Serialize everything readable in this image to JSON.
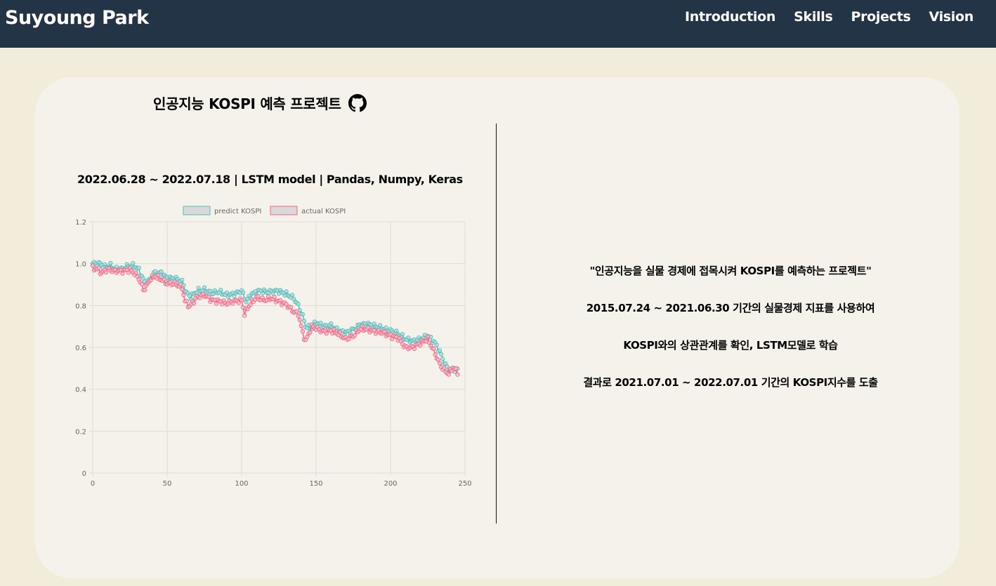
{
  "header": {
    "brand": "Suyoung Park",
    "nav": [
      "Introduction",
      "Skills",
      "Projects",
      "Vision"
    ]
  },
  "project": {
    "title": "인공지능 KOSPI 예측 프로젝트",
    "github_icon": "github-icon",
    "meta": "2022.06.28 ~ 2022.07.18 | LSTM model | Pandas, Numpy, Keras",
    "description": [
      "\"인공지능을 실물 경제에 접목시켜 KOSPI를 예측하는 프로젝트\"",
      "2015.07.24 ~ 2021.06.30 기간의 실물경제 지표를 사용하여",
      "KOSPI와의 상관관계를 확인, LSTM모델로 학습",
      "결과로 2021.07.01 ~ 2022.07.01 기간의 KOSPI지수를 도출"
    ]
  },
  "colors": {
    "navbar": "#243447",
    "background": "#f2ecdb",
    "card": "#f4f2ea",
    "predict": "#4bc0c0",
    "actual": "#ff6384"
  },
  "chart_data": {
    "type": "line",
    "grid": true,
    "legend": "top-center",
    "xlim": [
      0,
      250
    ],
    "ylim": [
      0,
      1.2
    ],
    "xticks": [
      0,
      50,
      100,
      150,
      200,
      250
    ],
    "yticks": [
      0,
      0.2,
      0.4,
      0.6,
      0.8,
      1.0,
      1.2
    ],
    "ytick_labels": [
      "0",
      "0.2",
      "0.4",
      "0.6",
      "0.8",
      "1.0",
      "1.2"
    ],
    "series": [
      {
        "name": "predict KOSPI",
        "color": "#4bc0c0",
        "knots": [
          [
            0,
            1.0
          ],
          [
            5,
            1.0
          ],
          [
            8,
            0.985
          ],
          [
            12,
            0.99
          ],
          [
            15,
            0.975
          ],
          [
            20,
            0.975
          ],
          [
            24,
            0.99
          ],
          [
            28,
            0.99
          ],
          [
            31,
            0.97
          ],
          [
            33,
            0.94
          ],
          [
            35,
            0.91
          ],
          [
            38,
            0.92
          ],
          [
            41,
            0.955
          ],
          [
            46,
            0.955
          ],
          [
            50,
            0.93
          ],
          [
            55,
            0.93
          ],
          [
            60,
            0.915
          ],
          [
            63,
            0.86
          ],
          [
            66,
            0.84
          ],
          [
            70,
            0.87
          ],
          [
            75,
            0.875
          ],
          [
            80,
            0.86
          ],
          [
            85,
            0.865
          ],
          [
            90,
            0.85
          ],
          [
            95,
            0.855
          ],
          [
            100,
            0.87
          ],
          [
            103,
            0.82
          ],
          [
            107,
            0.855
          ],
          [
            112,
            0.87
          ],
          [
            118,
            0.865
          ],
          [
            124,
            0.87
          ],
          [
            130,
            0.855
          ],
          [
            135,
            0.835
          ],
          [
            138,
            0.8
          ],
          [
            141,
            0.75
          ],
          [
            143,
            0.7
          ],
          [
            147,
            0.69
          ],
          [
            150,
            0.72
          ],
          [
            155,
            0.7
          ],
          [
            160,
            0.705
          ],
          [
            165,
            0.68
          ],
          [
            170,
            0.67
          ],
          [
            175,
            0.685
          ],
          [
            180,
            0.71
          ],
          [
            185,
            0.71
          ],
          [
            190,
            0.7
          ],
          [
            195,
            0.69
          ],
          [
            200,
            0.68
          ],
          [
            205,
            0.665
          ],
          [
            210,
            0.64
          ],
          [
            215,
            0.63
          ],
          [
            220,
            0.64
          ],
          [
            225,
            0.655
          ],
          [
            230,
            0.62
          ],
          [
            233,
            0.58
          ],
          [
            236,
            0.53
          ],
          [
            239,
            0.49
          ],
          [
            242,
            0.495
          ],
          [
            245,
            0.495
          ]
        ]
      },
      {
        "name": "actual KOSPI",
        "color": "#ff6384",
        "knots": [
          [
            0,
            0.98
          ],
          [
            4,
            0.97
          ],
          [
            6,
            0.955
          ],
          [
            10,
            0.975
          ],
          [
            14,
            0.965
          ],
          [
            20,
            0.965
          ],
          [
            25,
            0.97
          ],
          [
            28,
            0.955
          ],
          [
            31,
            0.93
          ],
          [
            34,
            0.875
          ],
          [
            36,
            0.89
          ],
          [
            39,
            0.93
          ],
          [
            42,
            0.94
          ],
          [
            47,
            0.92
          ],
          [
            50,
            0.905
          ],
          [
            55,
            0.905
          ],
          [
            60,
            0.885
          ],
          [
            62,
            0.82
          ],
          [
            65,
            0.795
          ],
          [
            70,
            0.84
          ],
          [
            75,
            0.85
          ],
          [
            80,
            0.825
          ],
          [
            85,
            0.82
          ],
          [
            90,
            0.81
          ],
          [
            95,
            0.82
          ],
          [
            100,
            0.825
          ],
          [
            102,
            0.76
          ],
          [
            105,
            0.8
          ],
          [
            110,
            0.84
          ],
          [
            115,
            0.825
          ],
          [
            120,
            0.835
          ],
          [
            125,
            0.82
          ],
          [
            130,
            0.805
          ],
          [
            135,
            0.77
          ],
          [
            138,
            0.76
          ],
          [
            141,
            0.67
          ],
          [
            143,
            0.63
          ],
          [
            147,
            0.7
          ],
          [
            150,
            0.69
          ],
          [
            155,
            0.675
          ],
          [
            160,
            0.68
          ],
          [
            165,
            0.665
          ],
          [
            170,
            0.64
          ],
          [
            175,
            0.655
          ],
          [
            180,
            0.69
          ],
          [
            185,
            0.685
          ],
          [
            190,
            0.675
          ],
          [
            195,
            0.67
          ],
          [
            200,
            0.655
          ],
          [
            205,
            0.645
          ],
          [
            210,
            0.6
          ],
          [
            215,
            0.6
          ],
          [
            220,
            0.62
          ],
          [
            225,
            0.64
          ],
          [
            230,
            0.57
          ],
          [
            233,
            0.52
          ],
          [
            236,
            0.49
          ],
          [
            239,
            0.475
          ],
          [
            242,
            0.505
          ],
          [
            245,
            0.48
          ]
        ]
      }
    ]
  }
}
